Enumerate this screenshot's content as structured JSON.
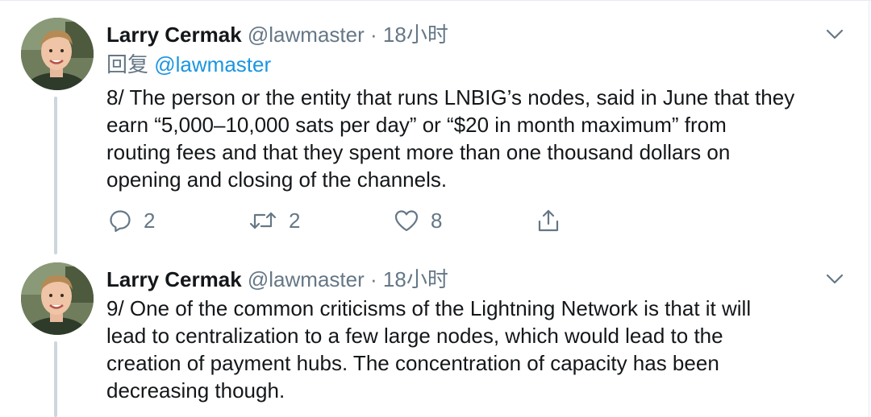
{
  "colors": {
    "text": "#14171a",
    "secondary": "#657786",
    "link": "#1b95e0",
    "thread_line": "#ccd6dd"
  },
  "tweets": [
    {
      "name": "Larry Cermak",
      "handle": "@lawmaster",
      "separator": "·",
      "time": "18小时",
      "reply_label": "回复",
      "reply_to": "@lawmaster",
      "lines": [
        "8/ The person or the entity that runs LNBIG’s nodes, said in June that they",
        "earn “5,000–10,000 sats per day” or “$20 in month maximum” from",
        "routing fees and that they spent more than one thousand dollars on",
        "opening and closing of the channels."
      ],
      "actions": {
        "replies": "2",
        "retweets": "2",
        "likes": "8"
      },
      "icons": [
        "reply-icon",
        "retweet-icon",
        "like-icon",
        "share-icon",
        "chevron-down-icon"
      ]
    },
    {
      "name": "Larry Cermak",
      "handle": "@lawmaster",
      "separator": "·",
      "time": "18小时",
      "lines": [
        "9/ One of the common criticisms of the Lightning Network is that it will",
        "lead to centralization to a few large nodes, which would lead to the",
        "creation of payment hubs. The concentration of capacity has been",
        "decreasing though."
      ],
      "icons": [
        "chevron-down-icon"
      ]
    }
  ]
}
